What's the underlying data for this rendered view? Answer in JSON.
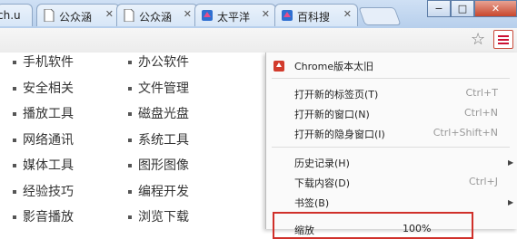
{
  "tabs": [
    {
      "label": "ch.u"
    },
    {
      "label": "公众涵"
    },
    {
      "label": "公众涵"
    },
    {
      "label": "太平洋"
    },
    {
      "label": "百科搜"
    }
  ],
  "window_controls": {
    "minimize": "−",
    "maximize": "□",
    "close": "✕"
  },
  "toolbar": {
    "star_icon": "star-icon",
    "menu_icon": "hamburger-icon"
  },
  "left_column": [
    "手机软件",
    "安全相关",
    "播放工具",
    "网络通讯",
    "媒体工具",
    "经验技巧",
    "影音播放"
  ],
  "right_column": [
    "办公软件",
    "文件管理",
    "磁盘光盘",
    "系统工具",
    "图形图像",
    "编程开发",
    "浏览下载"
  ],
  "menu": {
    "update": "Chrome版本太旧",
    "new_tab": {
      "label": "打开新的标签页(T)",
      "shortcut": "Ctrl+T"
    },
    "new_window": {
      "label": "打开新的窗口(N)",
      "shortcut": "Ctrl+N"
    },
    "incognito": {
      "label": "打开新的隐身窗口(I)",
      "shortcut": "Ctrl+Shift+N"
    },
    "history": "历史记录(H)",
    "downloads": {
      "label": "下载内容(D)",
      "shortcut": "Ctrl+J"
    },
    "bookmarks": "书签(B)",
    "zoom_label": "缩放",
    "zoom_value": "100%"
  }
}
